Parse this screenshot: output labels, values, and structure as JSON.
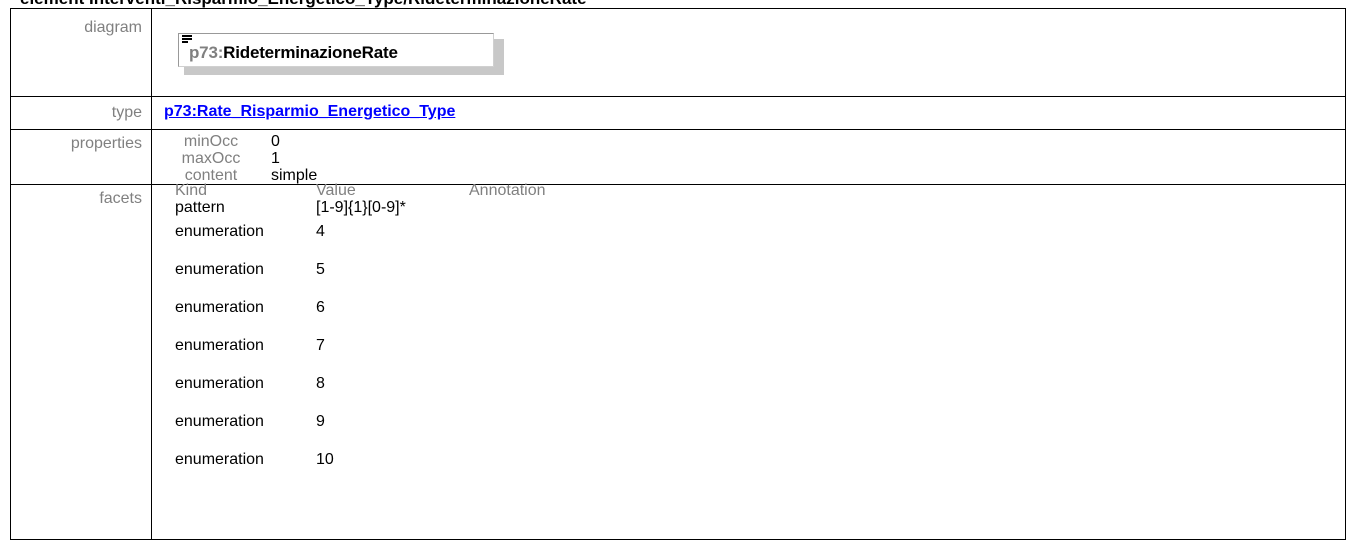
{
  "page_title": "element Interventi_Risparmio_Energetico_Type/RideterminazioneRate",
  "labels": {
    "diagram": "diagram",
    "type": "type",
    "properties": "properties",
    "facets": "facets"
  },
  "diagram": {
    "prefix": "p73:",
    "name": "RideterminazioneRate",
    "icon": "element-icon"
  },
  "type_link": "p73:Rate_Risparmio_Energetico_Type",
  "properties": [
    {
      "key": "minOcc",
      "value": "0"
    },
    {
      "key": "maxOcc",
      "value": "1"
    },
    {
      "key": "content",
      "value": "simple"
    }
  ],
  "facets": {
    "headers": [
      "Kind",
      "Value",
      "Annotation"
    ],
    "rows": [
      {
        "kind": "pattern",
        "value": "[1-9]{1}[0-9]*"
      },
      {
        "kind": "enumeration",
        "value": "4"
      },
      {
        "kind": "enumeration",
        "value": "5"
      },
      {
        "kind": "enumeration",
        "value": "6"
      },
      {
        "kind": "enumeration",
        "value": "7"
      },
      {
        "kind": "enumeration",
        "value": "8"
      },
      {
        "kind": "enumeration",
        "value": "9"
      },
      {
        "kind": "enumeration",
        "value": "10"
      }
    ]
  },
  "colors": {
    "label": "#808080",
    "link": "#0000ff",
    "border": "#000000",
    "diagram_shadow": "#c8c8c8"
  }
}
